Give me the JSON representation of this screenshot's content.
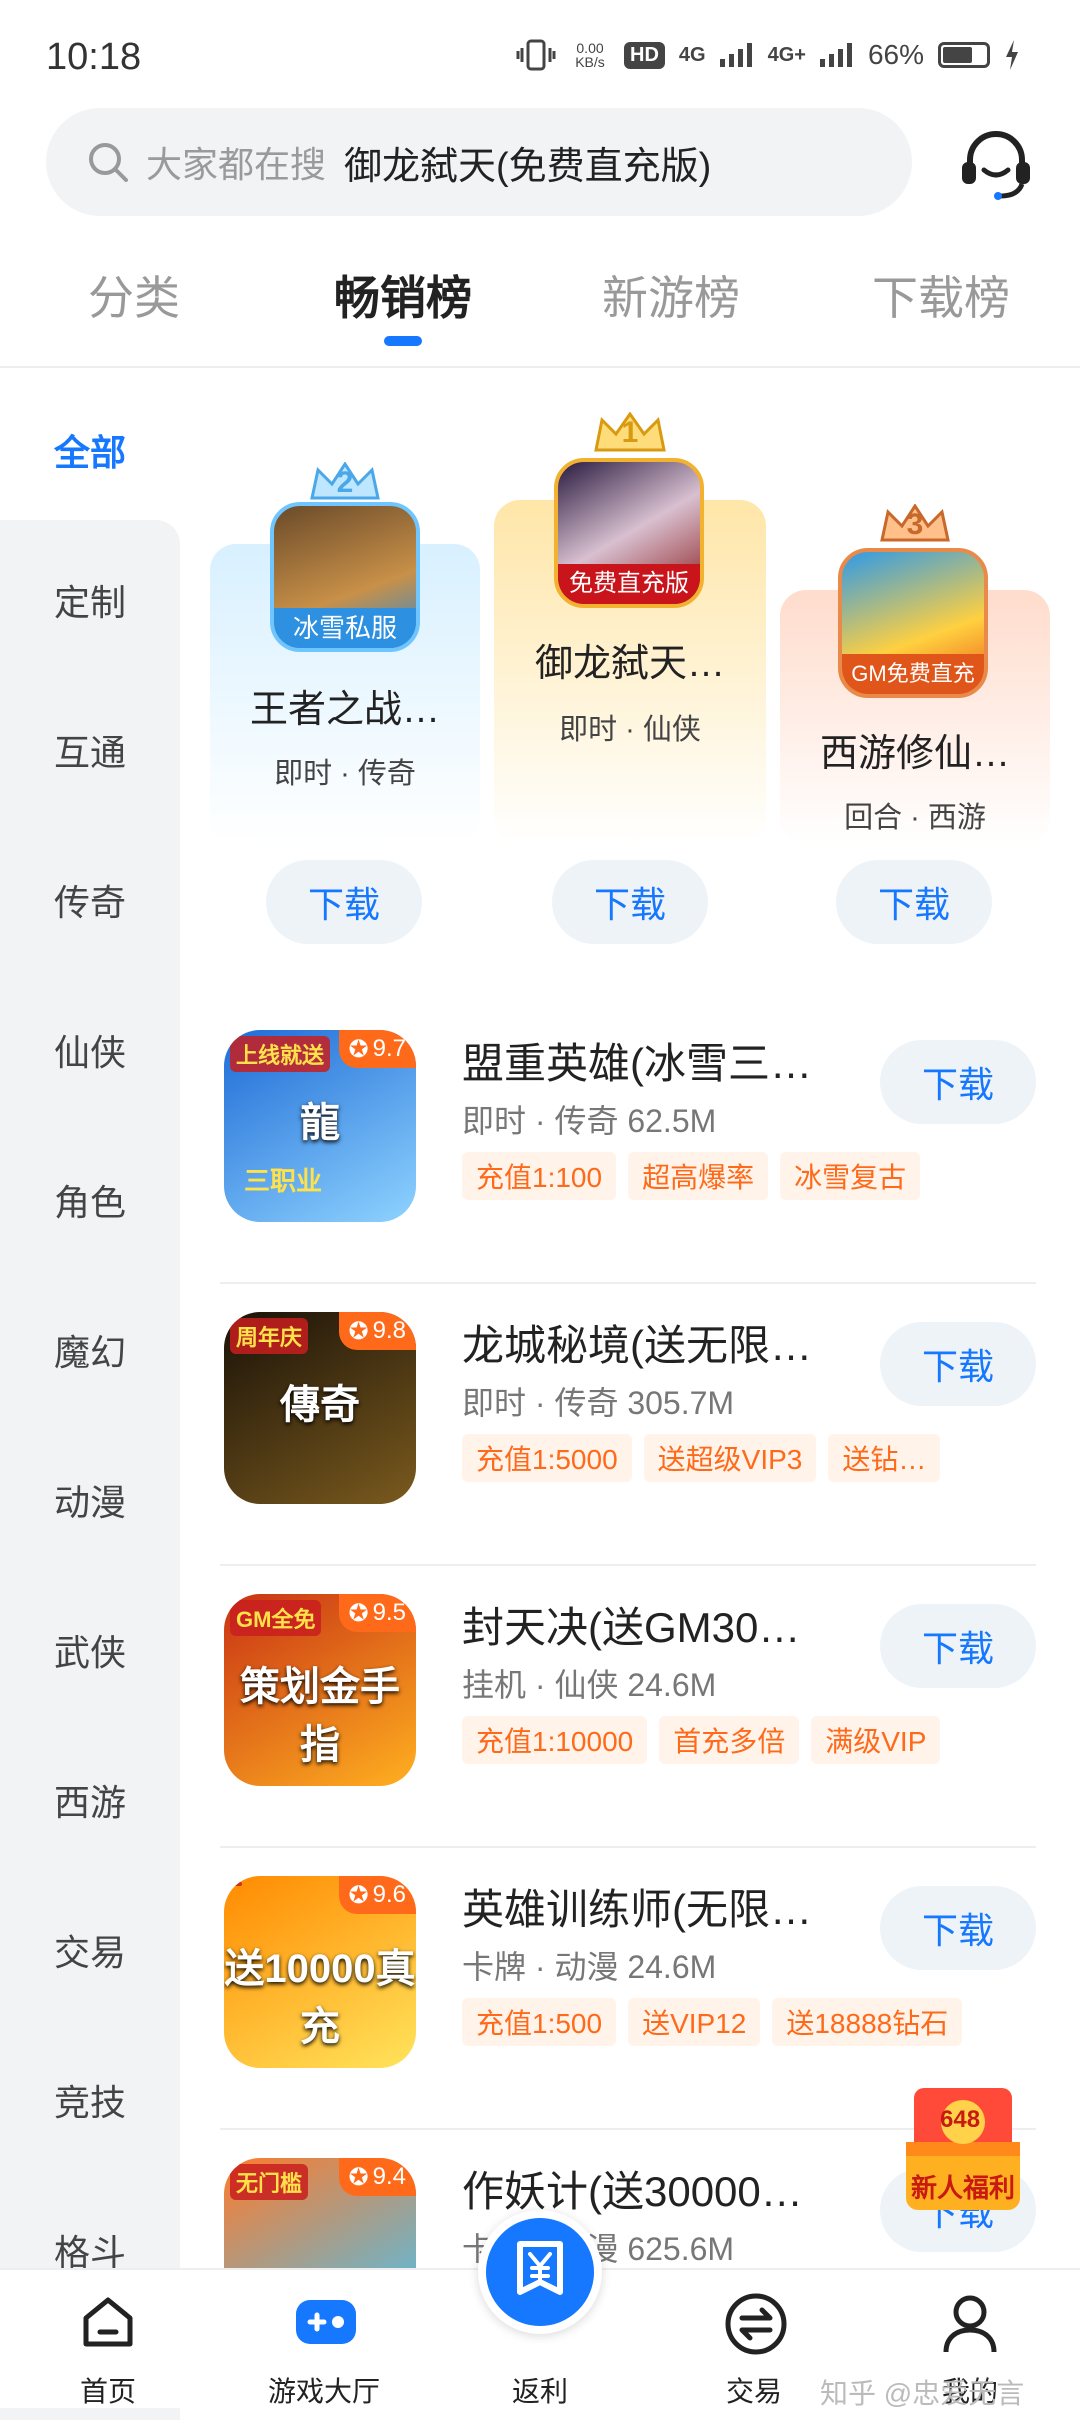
{
  "status_bar": {
    "time": "10:18",
    "net_speed": "0.00\nKB/s",
    "hd": "HD",
    "net1": "4G",
    "net2": "4G+",
    "battery": "66%",
    "battery_fraction": 0.66
  },
  "search": {
    "placeholder": "大家都在搜",
    "hot": "御龙弑天(免费直充版)"
  },
  "tabs": [
    "分类",
    "畅销榜",
    "新游榜",
    "下载榜"
  ],
  "sidebar": [
    "全部",
    "定制",
    "互通",
    "传奇",
    "仙侠",
    "角色",
    "魔幻",
    "动漫",
    "武侠",
    "西游",
    "交易",
    "竞技",
    "格斗"
  ],
  "podium": [
    {
      "rank": "2",
      "badge": "冰雪私服",
      "name": "王者之战…",
      "tags": "即时 · 传奇",
      "download": "下载",
      "color": "#dff3ff"
    },
    {
      "rank": "1",
      "badge": "免费直充版",
      "name": "御龙弑天…",
      "tags": "即时 · 仙侠",
      "download": "下载",
      "color": "#fff0cc"
    },
    {
      "rank": "3",
      "badge": "GM免费直充",
      "name": "西游修仙…",
      "tags": "回合 · 西游",
      "download": "下载",
      "color": "#ffe5d8"
    }
  ],
  "games": [
    {
      "name": "盟重英雄(冰雪三…",
      "meta": "即时 · 传奇   62.5M",
      "rating": "9.7",
      "tags": [
        "充值1:100",
        "超高爆率",
        "冰雪复古"
      ],
      "download": "下载",
      "icon_text": "龍",
      "icon_sub": "三职业",
      "icon_top": "上线就送",
      "c1": "#1e6bd6",
      "c2": "#8fd3ff"
    },
    {
      "name": "龙城秘境(送无限…",
      "meta": "即时 · 传奇   305.7M",
      "rating": "9.8",
      "tags": [
        "充值1:5000",
        "送超级VIP3",
        "送钻…"
      ],
      "download": "下载",
      "icon_text": "傳奇",
      "icon_sub": "",
      "icon_top": "周年庆",
      "c1": "#1a1208",
      "c2": "#7a5a1e"
    },
    {
      "name": "封天决(送GM30…",
      "meta": "挂机 · 仙侠   24.6M",
      "rating": "9.5",
      "tags": [
        "充值1:10000",
        "首充多倍",
        "满级VIP"
      ],
      "download": "下载",
      "icon_text": "策划金手指",
      "icon_sub": "",
      "icon_top": "GM全免",
      "c1": "#c83214",
      "c2": "#ffb020"
    },
    {
      "name": "英雄训练师(无限…",
      "meta": "卡牌 · 动漫   24.6M",
      "rating": "9.6",
      "tags": [
        "充值1:500",
        "送VIP12",
        "送18888钻石"
      ],
      "download": "下载",
      "icon_text": "送10000真充",
      "icon_sub": "",
      "icon_top": "",
      "c1": "#ff8a00",
      "c2": "#ffe45c"
    },
    {
      "name": "作妖计(送30000…",
      "meta": "卡牌 · 动漫   625.6M",
      "rating": "9.4",
      "tags": [],
      "download": "下载",
      "icon_text": "",
      "icon_sub": "",
      "icon_top": "无门槛",
      "c1": "#ff7a2a",
      "c2": "#3cc8ff"
    }
  ],
  "gift": {
    "label": "新人福利",
    "amount": "648"
  },
  "nav": [
    "首页",
    "游戏大厅",
    "返利",
    "交易",
    "我的"
  ],
  "watermark": "知乎 @忠爱无言",
  "colors": {
    "accent": "#1677ff",
    "tag": "#ff6a1a"
  }
}
